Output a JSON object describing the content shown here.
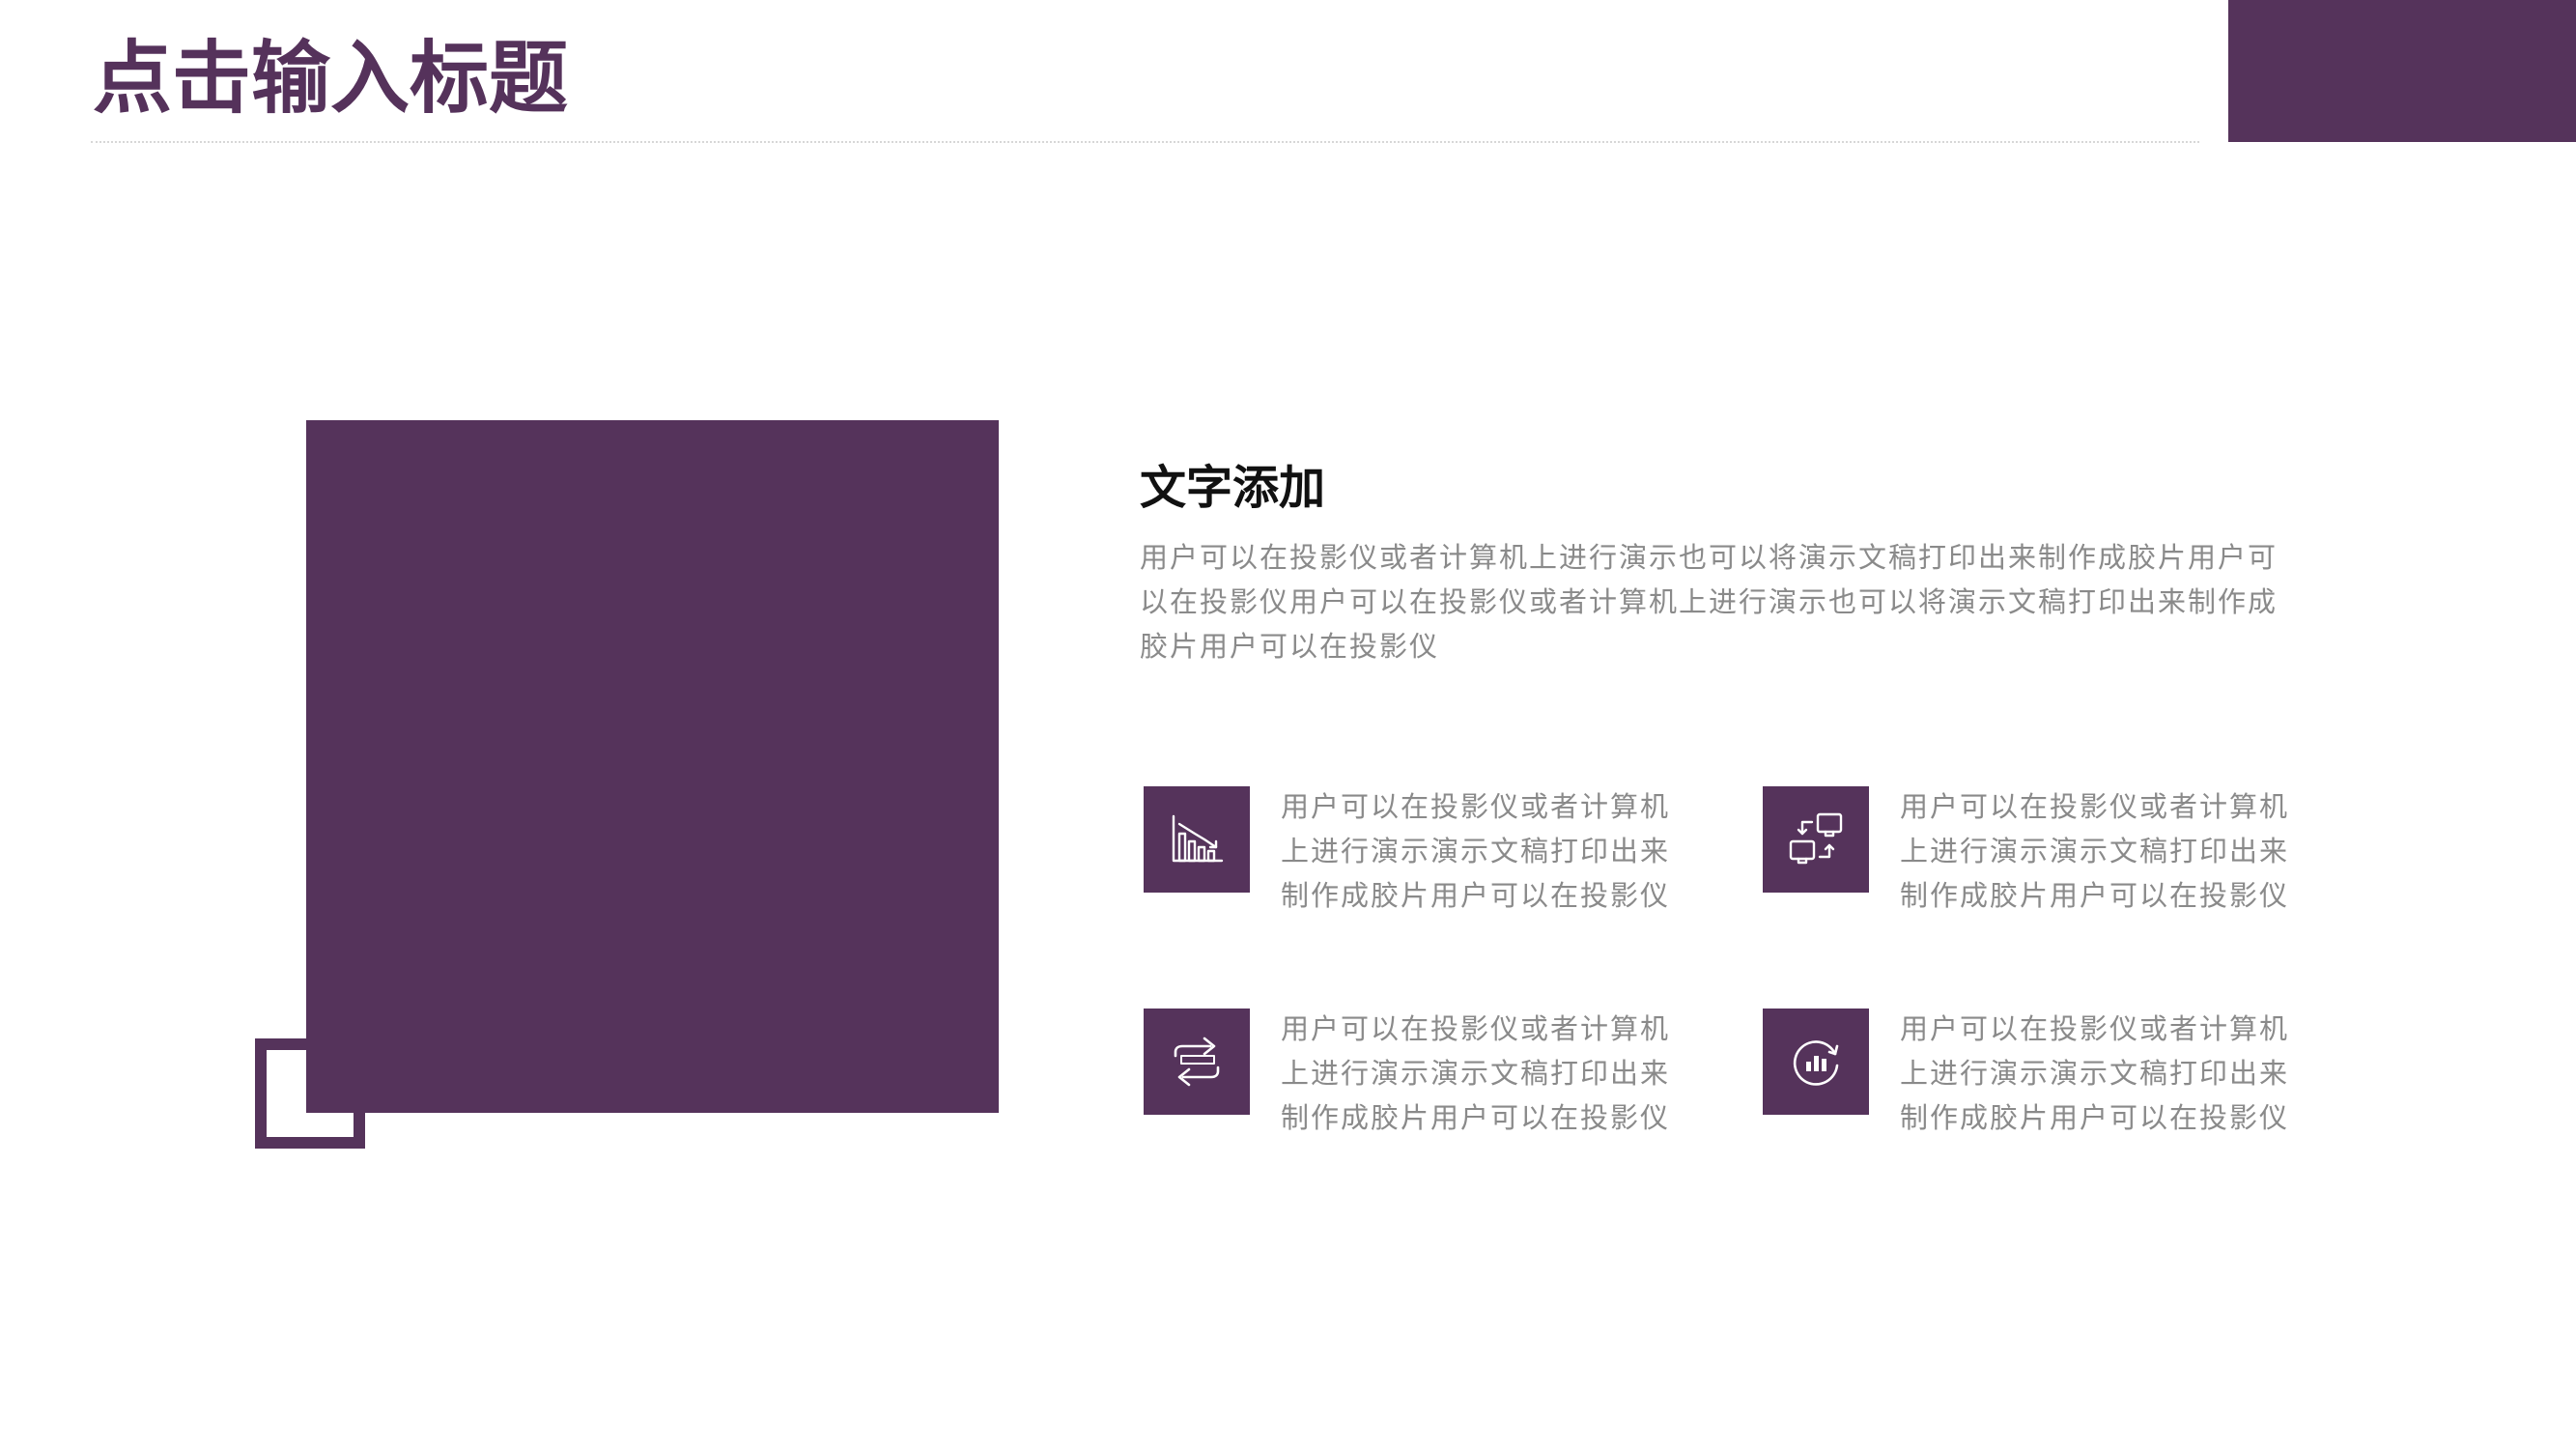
{
  "header": {
    "title": "点击输入标题"
  },
  "section": {
    "heading": "文字添加",
    "body": "用户可以在投影仪或者计算机上进行演示也可以将演示文稿打印出来制作成胶片用户可以在投影仪用户可以在投影仪或者计算机上进行演示也可以将演示文稿打印出来制作成胶片用户可以在投影仪"
  },
  "features": [
    {
      "icon": "declining-bar-chart-icon",
      "text": "用户可以在投影仪或者计算机上进行演示演示文稿打印出来制作成胶片用户可以在投影仪"
    },
    {
      "icon": "device-sync-icon",
      "text": "用户可以在投影仪或者计算机上进行演示演示文稿打印出来制作成胶片用户可以在投影仪"
    },
    {
      "icon": "swap-arrows-icon",
      "text": "用户可以在投影仪或者计算机上进行演示演示文稿打印出来制作成胶片用户可以在投影仪"
    },
    {
      "icon": "refresh-chart-icon",
      "text": "用户可以在投影仪或者计算机上进行演示演示文稿打印出来制作成胶片用户可以在投影仪"
    }
  ],
  "colors": {
    "accent": "#55335b",
    "heading_text": "#111111",
    "body_text": "#8a8a8a",
    "background": "#ffffff"
  }
}
